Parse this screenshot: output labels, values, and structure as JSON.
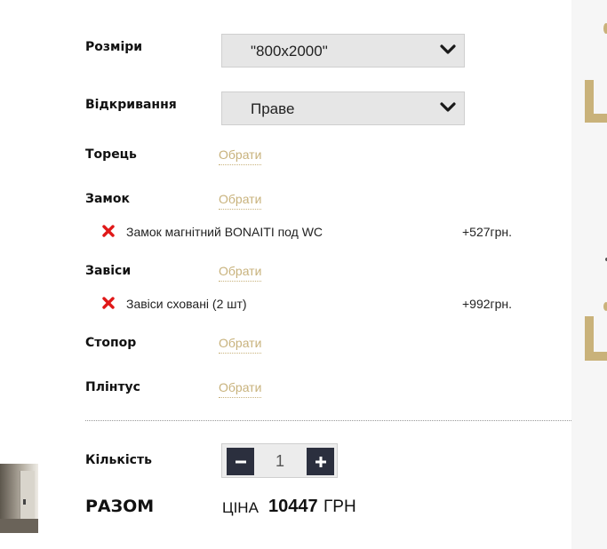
{
  "options": {
    "size": {
      "label": "Розміри",
      "value": "\"800x2000\""
    },
    "opening": {
      "label": "Відкривання",
      "value": "Праве"
    },
    "edge": {
      "label": "Торець",
      "pick": "Обрати"
    },
    "lock": {
      "label": "Замок",
      "pick": "Обрати",
      "items": [
        {
          "name": "Замок магнітний BONAITI под WC",
          "price": "+527грн."
        }
      ]
    },
    "hinges": {
      "label": "Завіси",
      "pick": "Обрати",
      "items": [
        {
          "name": "Завіси сховані (2 шт)",
          "price": "+992грн."
        }
      ]
    },
    "stopper": {
      "label": "Стопор",
      "pick": "Обрати"
    },
    "plinth": {
      "label": "Плінтус",
      "pick": "Обрати"
    }
  },
  "quantity": {
    "label": "Кількість",
    "value": "1"
  },
  "total": {
    "label": "РАЗОМ",
    "price_label": "ЦІНА",
    "price_value": "10447",
    "currency": "ГРН"
  },
  "colors": {
    "accent": "#c8b27c",
    "button": "#2b2f3e",
    "remove": "#e01818"
  },
  "icons": {
    "dropdown": "chevron-down-icon",
    "remove": "close-icon",
    "minus": "minus-icon",
    "plus": "plus-icon"
  }
}
